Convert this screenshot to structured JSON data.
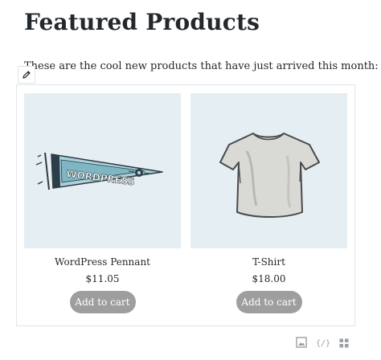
{
  "page": {
    "title": "Featured Products",
    "intro": "These are the cool new products that have just arrived this month:"
  },
  "products": [
    {
      "name": "WordPress Pennant",
      "price": "$11.05",
      "button_label": "Add to cart",
      "image_icon": "pennant-image",
      "pennant_text": "WORDPRESS",
      "image_bg": "#e5eef2"
    },
    {
      "name": "T-Shirt",
      "price": "$18.00",
      "button_label": "Add to cart",
      "image_icon": "tshirt-image",
      "image_bg": "#e5eef2"
    }
  ],
  "editor": {
    "edit_icon": "pencil-icon",
    "toolbar": [
      {
        "icon": "image-icon"
      },
      {
        "icon": "code-braces-icon",
        "label": "{/}"
      },
      {
        "icon": "grid-icon"
      }
    ]
  },
  "colors": {
    "button_bg": "#9e9e9e",
    "button_text": "#ffffff",
    "text": "#23282d",
    "border": "#e2e4e7"
  }
}
